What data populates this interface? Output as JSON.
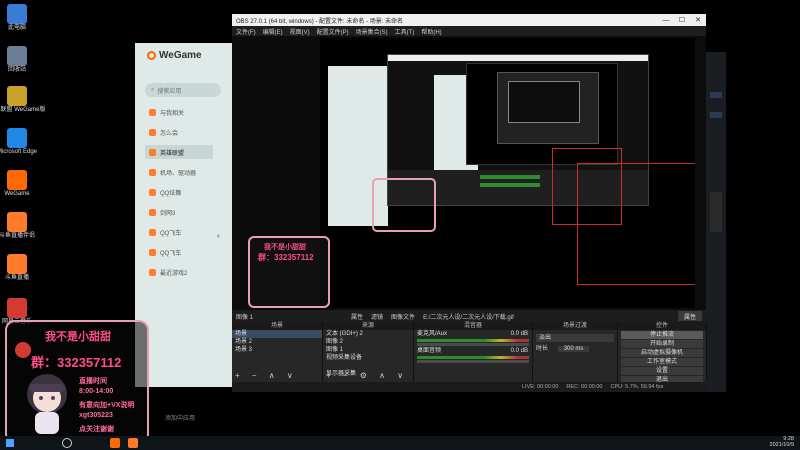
{
  "desktop": {
    "icons": [
      {
        "label": "此电脑",
        "icon": "computer-icon",
        "color": "#3a7bd5"
      },
      {
        "label": "回收站",
        "icon": "recycle-bin-icon",
        "color": "#6a7f96"
      },
      {
        "label": "英雄联盟 WeGame版",
        "icon": "league-icon",
        "color": "#c9a227"
      },
      {
        "label": "Microsoft Edge",
        "icon": "edge-icon",
        "color": "#1e88e5"
      },
      {
        "label": "WeGame",
        "icon": "wegame-icon",
        "color": "#ff6a00"
      },
      {
        "label": "斗鱼直播伴侣",
        "icon": "douyu-icon",
        "color": "#ff7a2a"
      },
      {
        "label": "斗鱼直播",
        "icon": "douyu-live-icon",
        "color": "#ff7a2a"
      },
      {
        "label": "网易云音乐",
        "icon": "music-icon",
        "color": "#d33a31"
      }
    ]
  },
  "wegame": {
    "title": "WeGame",
    "search_placeholder": "搜索应用",
    "items": [
      {
        "label": "与我相关",
        "active": false
      },
      {
        "label": "怎么会",
        "active": false
      },
      {
        "label": "英雄联盟",
        "active": true
      },
      {
        "label": "机场、驱动器",
        "active": false
      },
      {
        "label": "QQ炫舞",
        "active": false
      },
      {
        "label": "剑网3",
        "active": false
      },
      {
        "label": "QQ飞车",
        "active": false
      },
      {
        "label": "QQ飞车",
        "active": false
      },
      {
        "label": "最近游戏2",
        "active": false
      }
    ],
    "bottom": "添加中应用"
  },
  "obs": {
    "title": "OBS 27.0.1 (64 bit, windows) - 配置文件: 未命名 - 场景: 未命名",
    "menu": [
      "文件(F)",
      "编辑(E)",
      "视图(V)",
      "配置文件(P)",
      "场景集合(S)",
      "工具(T)",
      "帮助(H)"
    ],
    "source_bar": {
      "name": "图像 1",
      "props": "属性",
      "filters": "滤镜",
      "file_label": "图像文件",
      "file_path": "E:/二次元人设/二次元人设/下载.gif",
      "right_btn": "属性"
    },
    "docks": {
      "scenes": {
        "title": "场景",
        "rows": [
          "场景",
          "场景 2",
          "场景 3"
        ]
      },
      "sources": {
        "title": "来源",
        "rows": [
          "文本 (GDI+) 2",
          "图像 2",
          "图像 1",
          "视频采集设备",
          "",
          "显示器采集"
        ]
      },
      "mixer": {
        "title": "混音器",
        "rows": [
          "麦克风/Aux",
          "桌面音频"
        ],
        "levels": [
          "0.0 dB",
          "0.0 dB"
        ]
      },
      "transitions": {
        "title": "场景过渡",
        "mode": "淡出",
        "duration_label": "时长",
        "duration": "300 ms"
      },
      "controls": {
        "title": "控件",
        "buttons": [
          "停止推流",
          "开始录制",
          "启动虚拟摄像机",
          "工作室模式",
          "设置",
          "退出"
        ]
      }
    },
    "status": {
      "live": "LIVE: 00:00:00",
      "rec": "REC: 00:00:00",
      "cpu": "CPU: 5.7%, 59.94 fps"
    }
  },
  "overlay": {
    "header": "我不是小甜甜",
    "qq_label": "群：332357112",
    "lines": [
      "直播时间",
      "8:00-14:00",
      "有意向加+VX说明",
      "xgt305223",
      "点关注谢谢"
    ]
  },
  "taskbar": {
    "time": "9:28",
    "date": "2021/10/9"
  }
}
